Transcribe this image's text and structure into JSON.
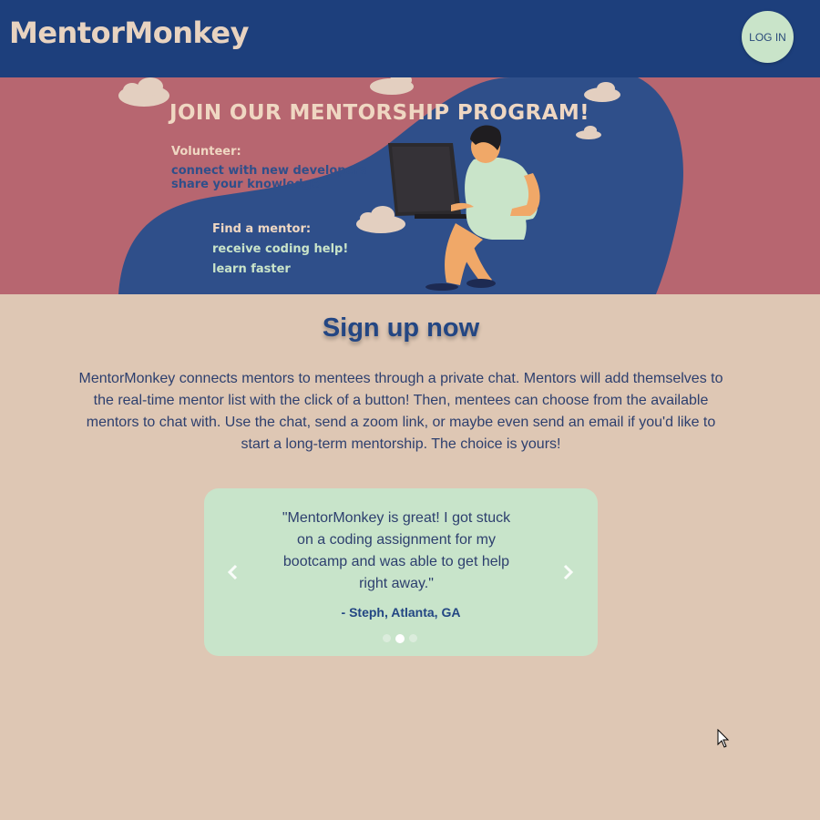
{
  "header": {
    "brand": "MentorMonkey",
    "login_label": "LOG IN"
  },
  "banner": {
    "title": "JOIN OUR MENTORSHIP PROGRAM!",
    "volunteer_heading": "Volunteer:",
    "volunteer_lines": [
      "connect with new developers",
      "share your knowledge"
    ],
    "mentor_heading": "Find a mentor:",
    "mentor_lines": [
      "receive coding help!",
      "learn faster"
    ]
  },
  "main": {
    "title": "Sign up now",
    "intro": "MentorMonkey connects mentors to mentees through a private chat. Mentors will add themselves to the real-time mentor list with the click of a button! Then, mentees can choose from the available mentors to chat with. Use the chat, send a zoom link, or maybe even send an email if you'd like to start a long-term mentorship. The choice is yours!"
  },
  "testimonial": {
    "quote": "\"MentorMonkey is great! I got stuck on a coding assignment for my bootcamp and was able to get help right away.\"",
    "author": "- Steph, Atlanta, GA",
    "slide_count": 3,
    "active_slide": 2,
    "prev_icon": "chevron-left-icon",
    "next_icon": "chevron-right-icon"
  },
  "colors": {
    "header_bg": "#1d3f7c",
    "banner_bg": "#b76670",
    "banner_blob": "#2f4f8a",
    "page_bg": "#dec7b4",
    "accent_green": "#c8e4ca",
    "title_blue": "#234683"
  }
}
